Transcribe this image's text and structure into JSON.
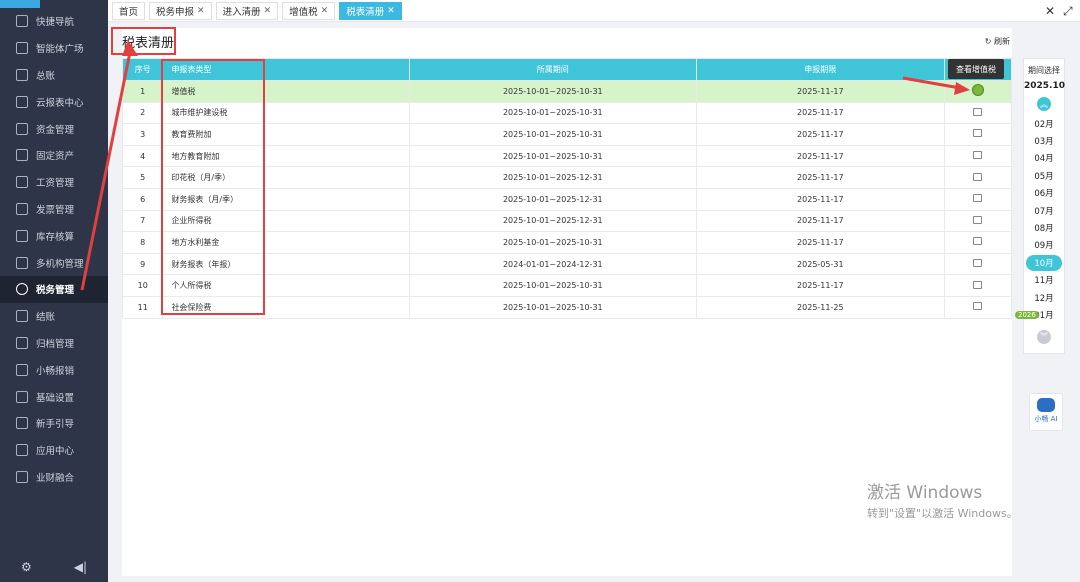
{
  "sidebar": {
    "items": [
      {
        "label": "快捷导航",
        "icon": "home-icon"
      },
      {
        "label": "智能体广场",
        "icon": "agent-icon"
      },
      {
        "label": "总账",
        "icon": "ledger-icon"
      },
      {
        "label": "云报表中心",
        "icon": "report-icon"
      },
      {
        "label": "资金管理",
        "icon": "money-icon"
      },
      {
        "label": "固定资产",
        "icon": "asset-icon"
      },
      {
        "label": "工资管理",
        "icon": "salary-icon"
      },
      {
        "label": "发票管理",
        "icon": "invoice-icon"
      },
      {
        "label": "库存核算",
        "icon": "inventory-icon"
      },
      {
        "label": "多机构管理",
        "icon": "org-icon"
      },
      {
        "label": "税务管理",
        "icon": "tax-icon",
        "active": true
      },
      {
        "label": "结账",
        "icon": "close-account-icon"
      },
      {
        "label": "归档管理",
        "icon": "archive-icon"
      },
      {
        "label": "小畅报销",
        "icon": "expense-icon"
      },
      {
        "label": "基础设置",
        "icon": "settings-icon"
      },
      {
        "label": "新手引导",
        "icon": "guide-icon"
      },
      {
        "label": "应用中心",
        "icon": "apps-icon"
      },
      {
        "label": "业财融合",
        "icon": "integration-icon"
      }
    ]
  },
  "tabs": [
    {
      "label": "首页",
      "closable": false
    },
    {
      "label": "税务申报",
      "closable": true
    },
    {
      "label": "进入清册",
      "closable": true
    },
    {
      "label": "增值税",
      "closable": true
    },
    {
      "label": "税表清册",
      "closable": true,
      "active": true
    }
  ],
  "page": {
    "title": "税表清册",
    "refresh_label": "刷新",
    "tooltip": "查看增值税"
  },
  "table": {
    "headers": [
      "序号",
      "申报表类型",
      "所属期间",
      "申报期限",
      ""
    ],
    "rows": [
      {
        "no": "1",
        "name": "增值税",
        "period": "2025-10-01~2025-10-31",
        "deadline": "2025-11-17",
        "selected": true
      },
      {
        "no": "2",
        "name": "城市维护建设税",
        "period": "2025-10-01~2025-10-31",
        "deadline": "2025-11-17"
      },
      {
        "no": "3",
        "name": "教育费附加",
        "period": "2025-10-01~2025-10-31",
        "deadline": "2025-11-17"
      },
      {
        "no": "4",
        "name": "地方教育附加",
        "period": "2025-10-01~2025-10-31",
        "deadline": "2025-11-17"
      },
      {
        "no": "5",
        "name": "印花税（月/季）",
        "period": "2025-10-01~2025-12-31",
        "deadline": "2025-11-17"
      },
      {
        "no": "6",
        "name": "财务报表（月/季）",
        "period": "2025-10-01~2025-12-31",
        "deadline": "2025-11-17"
      },
      {
        "no": "7",
        "name": "企业所得税",
        "period": "2025-10-01~2025-12-31",
        "deadline": "2025-11-17"
      },
      {
        "no": "8",
        "name": "地方水利基金",
        "period": "2025-10-01~2025-10-31",
        "deadline": "2025-11-17"
      },
      {
        "no": "9",
        "name": "财务报表（年报）",
        "period": "2024-01-01~2024-12-31",
        "deadline": "2025-05-31"
      },
      {
        "no": "10",
        "name": "个人所得税",
        "period": "2025-10-01~2025-10-31",
        "deadline": "2025-11-17"
      },
      {
        "no": "11",
        "name": "社会保险费",
        "period": "2025-10-01~2025-10-31",
        "deadline": "2025-11-25"
      }
    ]
  },
  "period_selector": {
    "label": "期间选择",
    "current": "2025.10",
    "months": [
      "02月",
      "03月",
      "04月",
      "05月",
      "06月",
      "07月",
      "08月",
      "09月",
      "10月",
      "11月",
      "12月",
      "01月"
    ],
    "active_month": "10月",
    "year_tag": "2026"
  },
  "ai": {
    "label": "小畅 AI"
  },
  "watermark": {
    "line1": "激活 Windows",
    "line2": "转到\"设置\"以激活 Windows。"
  },
  "colors": {
    "accent": "#3fc4d8",
    "sidebar": "#2f3549",
    "highlight_row": "#d6f3c9",
    "annotation": "#e04040"
  }
}
